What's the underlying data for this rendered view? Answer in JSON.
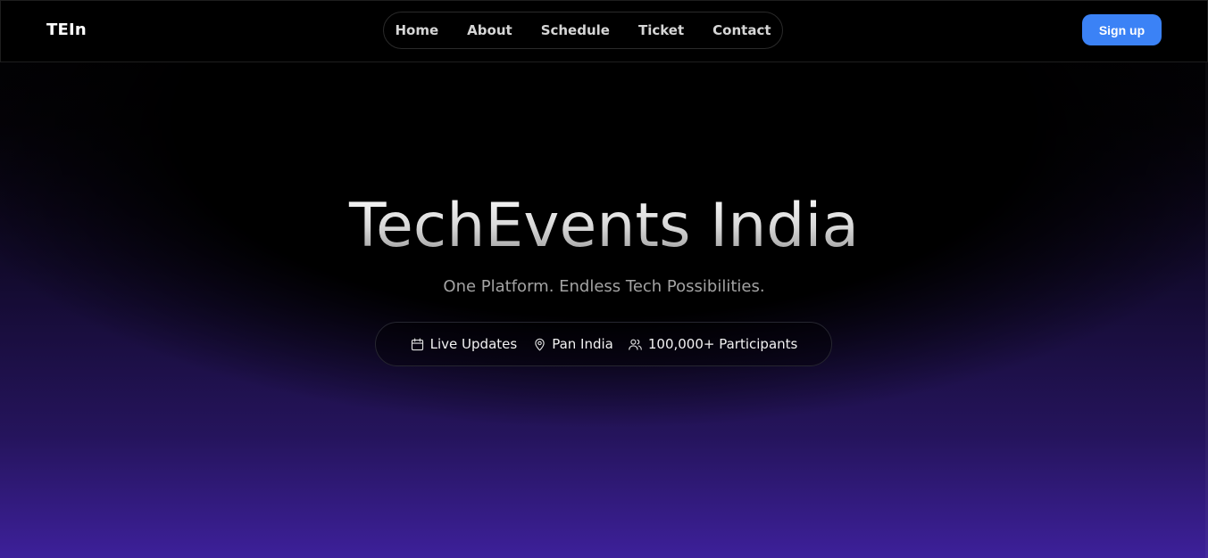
{
  "brand": {
    "name": "TEIn"
  },
  "nav": {
    "items": [
      {
        "label": "Home"
      },
      {
        "label": "About"
      },
      {
        "label": "Schedule"
      },
      {
        "label": "Ticket"
      },
      {
        "label": "Contact"
      }
    ]
  },
  "header": {
    "signup_label": "Sign up",
    "signup_color": "#3b82f6"
  },
  "hero": {
    "title": "TechEvents India",
    "subtitle": "One Platform. Endless Tech Possibilities.",
    "info": [
      {
        "icon": "calendar-icon",
        "label": "Live Updates"
      },
      {
        "icon": "map-pin-icon",
        "label": "Pan India"
      },
      {
        "icon": "users-icon",
        "label": "100,000+ Participants"
      }
    ]
  },
  "colors": {
    "background": "#000000",
    "gradient_bottom": "#3d209a",
    "accent": "#3b82f6"
  }
}
